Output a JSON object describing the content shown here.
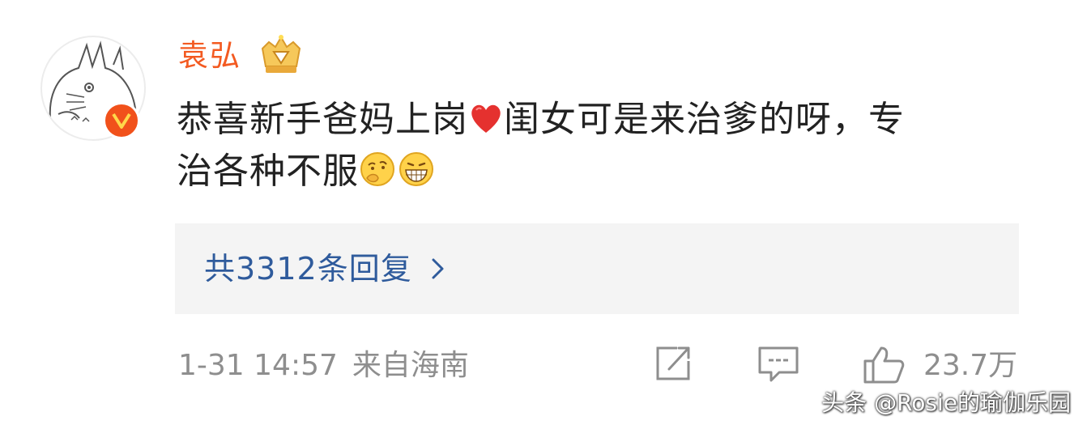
{
  "user": {
    "name": "袁弘"
  },
  "comment": {
    "line1_before_heart": "恭喜新手爸妈上岗",
    "line1_after_heart": "闺女可是来治爹的呀，专",
    "line2": "治各种不服"
  },
  "replies": {
    "label": "共3312条回复"
  },
  "meta": {
    "time": "1-31 14:57",
    "source": "来自海南"
  },
  "actions": {
    "likes": "23.7万"
  },
  "watermark": {
    "text": "头条 @Rosie的瑜伽乐园"
  },
  "colors": {
    "username": "#f35a21",
    "link": "#2f5b9c",
    "meta": "#8e8e8e",
    "verified_badge": "#f1511b"
  },
  "icons": [
    "verified-badge-icon",
    "crown-badge-icon",
    "heart-icon",
    "thinking-emoji-icon",
    "grin-emoji-icon",
    "chevron-right-icon",
    "share-icon",
    "comment-icon",
    "like-icon"
  ]
}
